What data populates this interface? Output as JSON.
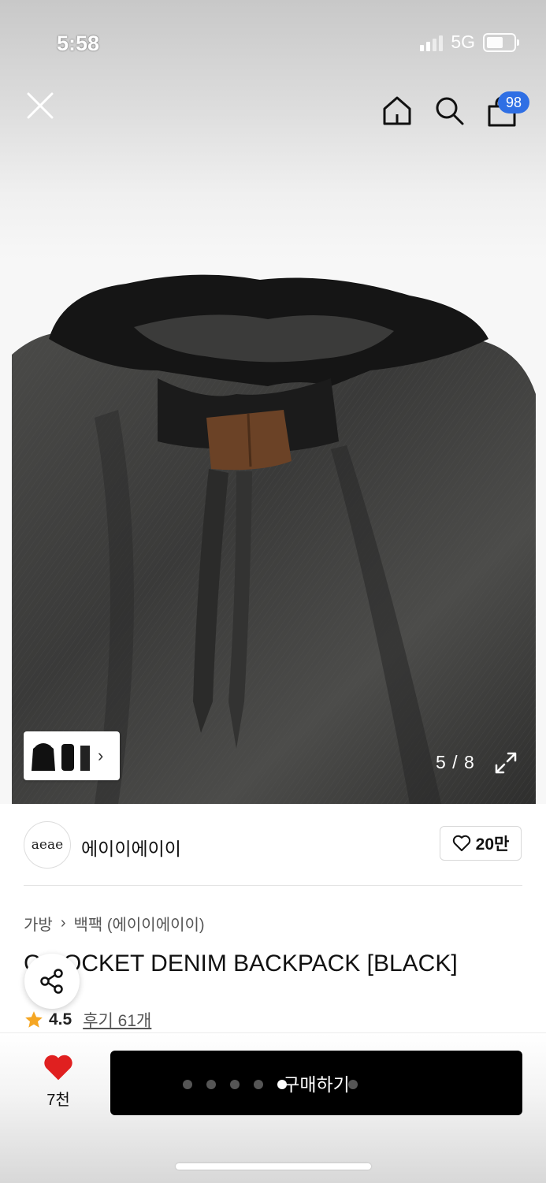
{
  "status_bar": {
    "time": "5:58",
    "network": "5G"
  },
  "header": {
    "cart_badge": "98",
    "icons": [
      "close-icon",
      "home-icon",
      "search-icon",
      "shopping-bag-icon"
    ]
  },
  "gallery": {
    "counter": "5 / 8",
    "thumb_arrow": "›"
  },
  "brand": {
    "logo_text": "aeae",
    "name": "에이이에이이",
    "likes": "20만"
  },
  "breadcrumb": {
    "category": "가방",
    "separator": "›",
    "subcategory": "백팩 (에이이에이이)"
  },
  "product": {
    "title": "C   POCKET DENIM BACKPACK [BLACK]"
  },
  "rating": {
    "score": "4.5",
    "reviews": "후기 61개"
  },
  "bottom": {
    "wish_count": "7천",
    "buy_label": "구매하기"
  },
  "colors": {
    "accent_blue": "#2f6fe4",
    "heart_red": "#e02020",
    "star": "#f5a623",
    "buy_button": "#000000"
  }
}
